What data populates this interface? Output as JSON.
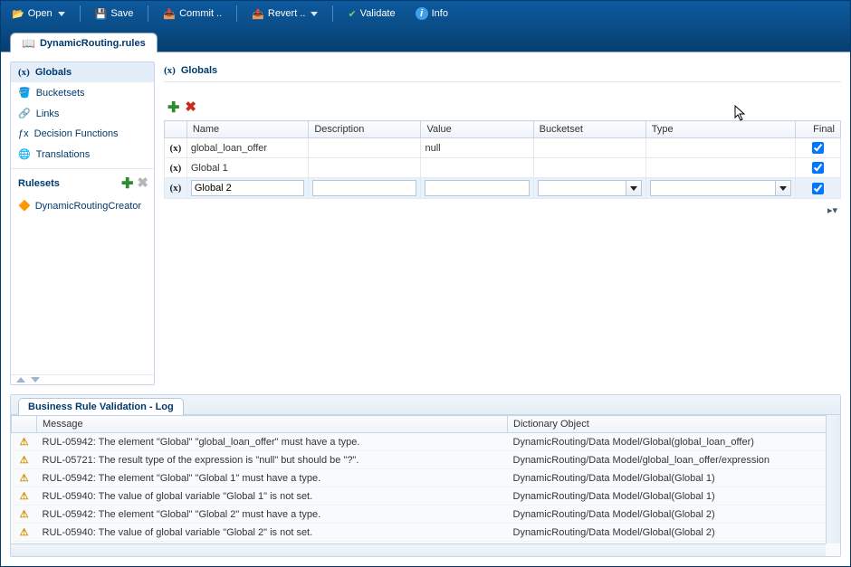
{
  "toolbar": {
    "open": "Open",
    "save": "Save",
    "commit": "Commit ..",
    "revert": "Revert ..",
    "validate": "Validate",
    "info": "Info"
  },
  "tab": {
    "title": "DynamicRouting.rules"
  },
  "sidebar": {
    "items": [
      {
        "label": "Globals",
        "icon": "(x)"
      },
      {
        "label": "Bucketsets",
        "icon": "bucket"
      },
      {
        "label": "Links",
        "icon": "link"
      },
      {
        "label": "Decision Functions",
        "icon": "fn"
      },
      {
        "label": "Translations",
        "icon": "globe"
      }
    ],
    "rulesets_label": "Rulesets",
    "rulesets": [
      {
        "label": "DynamicRoutingCreator"
      }
    ]
  },
  "content": {
    "title": "Globals",
    "columns": [
      "Name",
      "Description",
      "Value",
      "Bucketset",
      "Type",
      "Final"
    ],
    "col_icon_header": "",
    "rows": [
      {
        "name": "global_loan_offer",
        "description": "",
        "value": "null",
        "bucketset": "",
        "type": "",
        "final": true,
        "editing": false
      },
      {
        "name": "Global 1",
        "description": "",
        "value": "",
        "bucketset": "",
        "type": "",
        "final": true,
        "editing": false
      },
      {
        "name": "Global 2",
        "description": "",
        "value": "",
        "bucketset": "",
        "type": "",
        "final": true,
        "editing": true
      }
    ]
  },
  "bottom": {
    "tab_label": "Business Rule Validation - Log",
    "columns": [
      "",
      "Message",
      "Dictionary Object"
    ],
    "rows": [
      {
        "msg": "RUL-05942: The element \"Global\" \"global_loan_offer\" must have a type.",
        "obj": "DynamicRouting/Data Model/Global(global_loan_offer)"
      },
      {
        "msg": "RUL-05721: The result type of the expression is \"null\" but should be \"?\".",
        "obj": "DynamicRouting/Data Model/global_loan_offer/expression"
      },
      {
        "msg": "RUL-05942: The element \"Global\" \"Global 1\" must have a type.",
        "obj": "DynamicRouting/Data Model/Global(Global 1)"
      },
      {
        "msg": "RUL-05940: The value of global variable \"Global 1\" is not set.",
        "obj": "DynamicRouting/Data Model/Global(Global 1)"
      },
      {
        "msg": "RUL-05942: The element \"Global\" \"Global 2\" must have a type.",
        "obj": "DynamicRouting/Data Model/Global(Global 2)"
      },
      {
        "msg": "RUL-05940: The value of global variable \"Global 2\" is not set.",
        "obj": "DynamicRouting/Data Model/Global(Global 2)"
      }
    ]
  },
  "icons": {
    "x": "(x)",
    "plus": "✚",
    "del": "✖",
    "warn": "⚠"
  }
}
